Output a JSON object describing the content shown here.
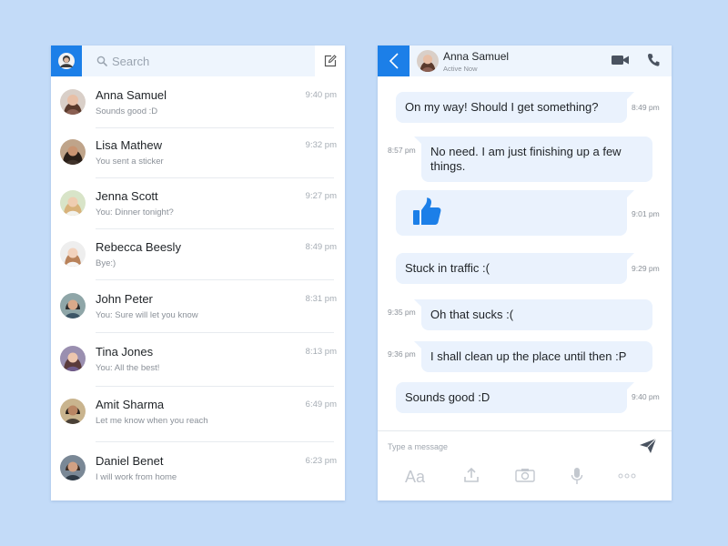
{
  "contacts_panel": {
    "search": {
      "placeholder": "Search"
    },
    "contacts": [
      {
        "name": "Anna Samuel",
        "message": "Sounds good :D",
        "time": "9:40 pm"
      },
      {
        "name": "Lisa Mathew",
        "message": "You sent a sticker",
        "time": "9:32 pm"
      },
      {
        "name": "Jenna Scott",
        "message": "You: Dinner tonight?",
        "time": "9:27 pm"
      },
      {
        "name": "Rebecca Beesly",
        "message": "Bye:)",
        "time": "8:49 pm"
      },
      {
        "name": "John Peter",
        "message": "You: Sure will let you know",
        "time": "8:31 pm"
      },
      {
        "name": "Tina Jones",
        "message": "You: All the best!",
        "time": "8:13 pm"
      },
      {
        "name": "Amit Sharma",
        "message": "Let me know when you reach",
        "time": "6:49 pm"
      },
      {
        "name": "Daniel Benet",
        "message": "I will work from home",
        "time": "6:23 pm"
      }
    ]
  },
  "chat_panel": {
    "header": {
      "name": "Anna Samuel",
      "status": "Active Now"
    },
    "messages": [
      {
        "direction": "outgoing",
        "text": "On my way! Should I get something?",
        "time": "8:49 pm"
      },
      {
        "direction": "incoming",
        "text": "No need. I am just finishing up a few things.",
        "time": "8:57 pm"
      },
      {
        "direction": "outgoing",
        "text": "",
        "sticker": "thumbs-up-icon",
        "time": "9:01 pm"
      },
      {
        "direction": "outgoing",
        "text": "Stuck in traffic :(",
        "time": "9:29 pm"
      },
      {
        "direction": "incoming",
        "text": "Oh that sucks :(",
        "time": "9:35 pm"
      },
      {
        "direction": "incoming",
        "text": "I shall clean up the place until then :P",
        "time": "9:36 pm"
      },
      {
        "direction": "outgoing",
        "text": "Sounds good :D",
        "time": "9:40 pm"
      }
    ],
    "composer": {
      "placeholder": "Type a message",
      "font_button_label": "Aa",
      "tools": [
        "font-icon",
        "upload-icon",
        "camera-icon",
        "microphone-icon",
        "more-icon"
      ]
    }
  },
  "colors": {
    "background": "#c3dbf8",
    "accent": "#1c7fe8",
    "bubble": "#eaf2fd",
    "header": "#eef5fd"
  }
}
